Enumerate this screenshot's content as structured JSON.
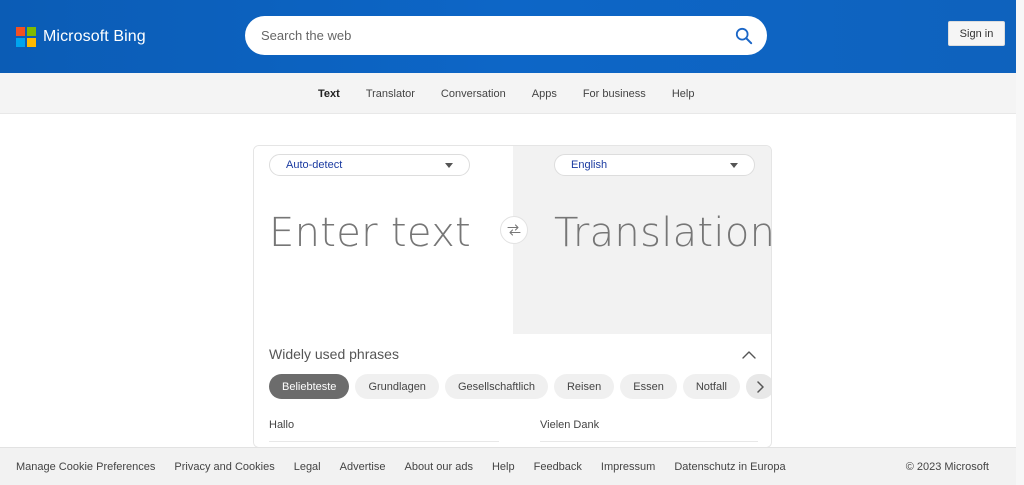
{
  "header": {
    "brand": "Microsoft Bing",
    "logo_colors": [
      "#f25022",
      "#7fba00",
      "#00a4ef",
      "#ffb900"
    ],
    "search_placeholder": "Search the web",
    "search_icon": "search-icon",
    "sign_in": "Sign in"
  },
  "nav": {
    "items": [
      {
        "label": "Text",
        "active": true
      },
      {
        "label": "Translator",
        "active": false
      },
      {
        "label": "Conversation",
        "active": false
      },
      {
        "label": "Apps",
        "active": false
      },
      {
        "label": "For business",
        "active": false
      },
      {
        "label": "Help",
        "active": false
      }
    ]
  },
  "translator": {
    "source_lang": "Auto-detect",
    "target_lang": "English",
    "input_placeholder": "Enter text",
    "output_placeholder": "Translation",
    "swap_icon": "swap-arrows-icon"
  },
  "phrases": {
    "title": "Widely used phrases",
    "chips": [
      {
        "label": "Beliebteste",
        "active": true
      },
      {
        "label": "Grundlagen",
        "active": false
      },
      {
        "label": "Gesellschaftlich",
        "active": false
      },
      {
        "label": "Reisen",
        "active": false
      },
      {
        "label": "Essen",
        "active": false
      },
      {
        "label": "Notfall",
        "active": false
      }
    ],
    "items": [
      "Hallo",
      "Vielen Dank"
    ]
  },
  "footer": {
    "links": [
      "Manage Cookie Preferences",
      "Privacy and Cookies",
      "Legal",
      "Advertise",
      "About our ads",
      "Help",
      "Feedback",
      "Impressum",
      "Datenschutz in Europa"
    ],
    "copyright": "© 2023 Microsoft"
  },
  "colors": {
    "header_blue": "#0d66c7",
    "lang_text": "#1a3aa0",
    "active_chip": "#6c6c6c"
  }
}
